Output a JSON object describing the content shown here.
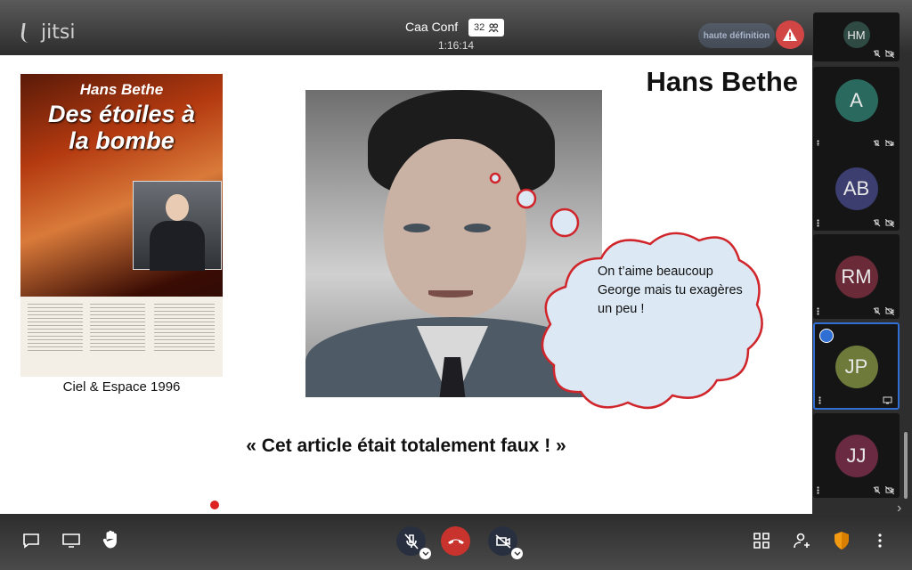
{
  "app": {
    "logo_text": "jitsi"
  },
  "header": {
    "conference_name": "Caa Conf",
    "participant_count": "32",
    "duration": "1:16:14",
    "quality_label": "haute définition",
    "warning_icon": "warning-triangle-icon"
  },
  "slide": {
    "title": "Hans Bethe",
    "book": {
      "author": "Hans Bethe",
      "title_line1": "Des étoiles à",
      "title_line2": "la bombe",
      "caption": "Ciel & Espace 1996"
    },
    "bubble_line1": "On t’aime beaucoup",
    "bubble_line2": "George mais tu exagères",
    "bubble_line3": "un peu !",
    "quote": "« Cet article était totalement faux ! »"
  },
  "filmstrip": {
    "participants": [
      {
        "initials": "HM",
        "color": "#2e4a42"
      },
      {
        "initials": "A",
        "color": "#2a6a5e"
      },
      {
        "initials": "AB",
        "color": "#3b3e6e"
      },
      {
        "initials": "RM",
        "color": "#6a2a38"
      },
      {
        "initials": "JP",
        "color": "#6e7a3a",
        "active": true
      },
      {
        "initials": "JJ",
        "color": "#6a2a42"
      }
    ]
  },
  "toolbar": {
    "left": [
      "chat-icon",
      "screenshare-icon",
      "raise-hand-icon"
    ],
    "center": [
      "microphone-muted-icon",
      "hangup-icon",
      "camera-off-icon"
    ],
    "right": [
      "tile-view-icon",
      "participants-icon",
      "security-shield-icon",
      "more-options-icon"
    ],
    "colors": {
      "hangup": "#c8342d",
      "shield": "#f29b12",
      "active_border": "#2f6fd4"
    }
  }
}
